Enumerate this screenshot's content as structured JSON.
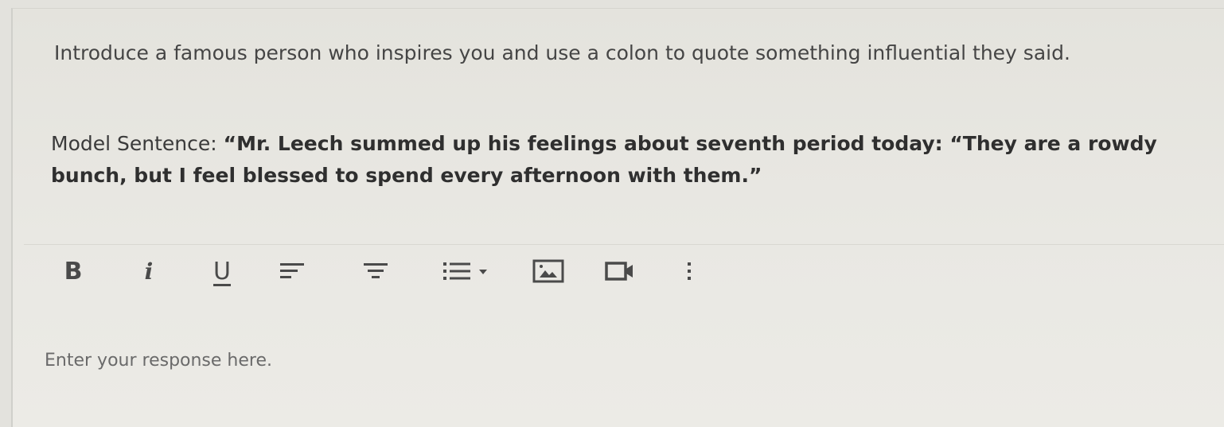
{
  "question": {
    "prompt": "Introduce a famous person who inspires you and use a colon to quote something influential they said.",
    "model_label": "Model Sentence: ",
    "model_quote": "“Mr. Leech summed up his feelings about seventh period today: “They are a rowdy bunch, but I feel blessed to spend every afternoon with them.”"
  },
  "toolbar": {
    "bold_label": "B",
    "italic_label": "i",
    "underline_label": "U",
    "icons": [
      "align-left-icon",
      "align-center-icon",
      "bulleted-list-icon",
      "dropdown-arrow-icon",
      "image-icon",
      "video-icon",
      "more-options-icon"
    ]
  },
  "editor": {
    "placeholder": "Enter your response here."
  }
}
